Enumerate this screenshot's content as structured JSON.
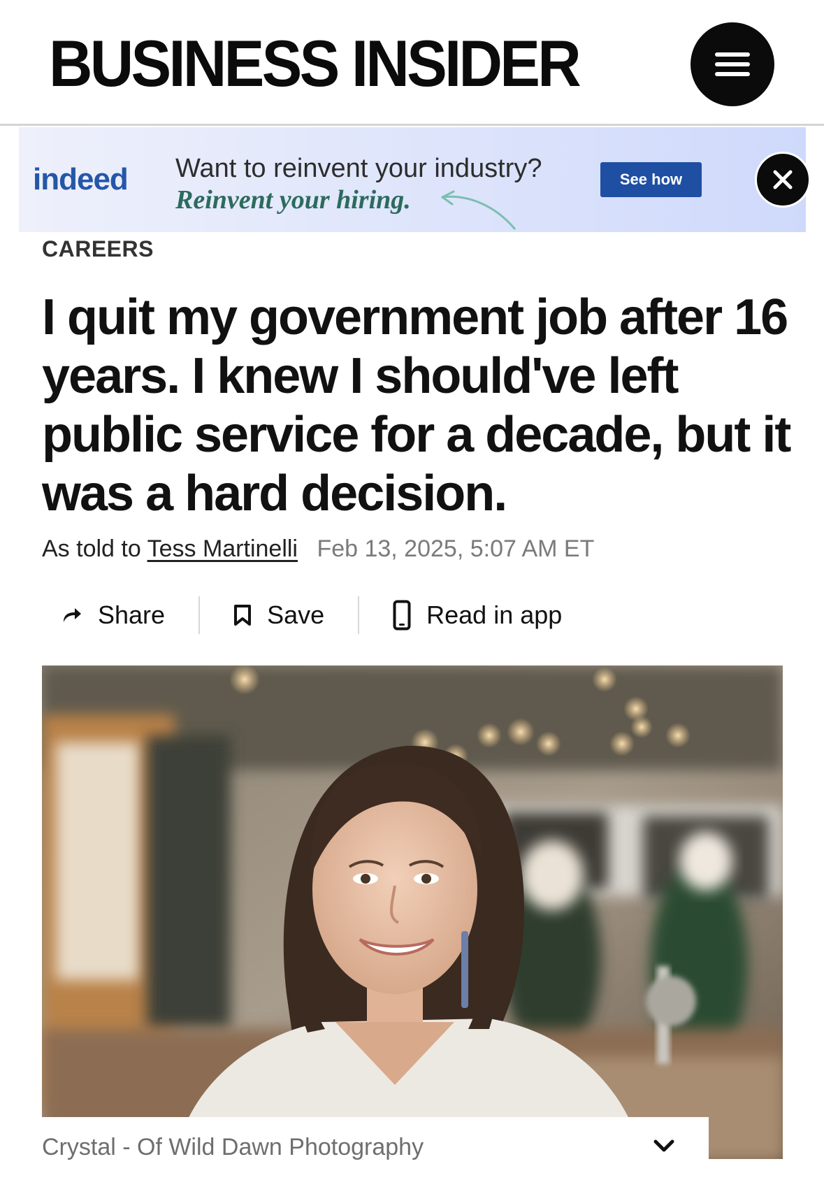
{
  "header": {
    "logo_text": "BUSINESS INSIDER",
    "menu_icon": "hamburger-menu-icon"
  },
  "ad": {
    "brand": "indeed",
    "headline": "Want to reinvent your industry?",
    "tagline": "Reinvent your hiring.",
    "cta_label": "See how",
    "close_icon": "close-x-icon",
    "brand_color": "#2557a7",
    "cta_color": "#1f4fa3"
  },
  "article": {
    "section": "CAREERS",
    "headline": "I quit my government job after 16 years. I knew I should've left public service for a decade, but it was a hard decision.",
    "byline_prefix": "As told to",
    "author": "Tess Martinelli",
    "date": "Feb 13, 2025, 5:07 AM ET"
  },
  "actions": {
    "share_label": "Share",
    "save_label": "Save",
    "read_in_app_label": "Read in app"
  },
  "photo": {
    "caption": "Crystal - Of Wild Dawn Photography",
    "expand_icon": "chevron-down-icon"
  }
}
